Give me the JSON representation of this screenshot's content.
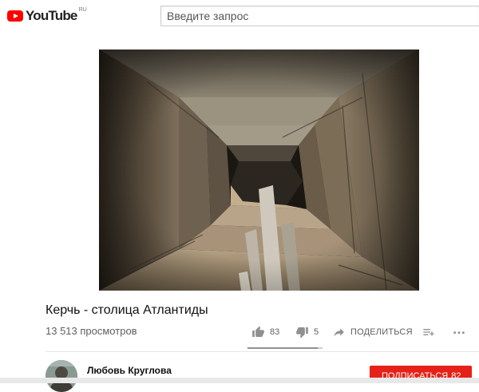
{
  "header": {
    "logo_text": "YouTube",
    "logo_region": "RU",
    "brand_color": "#ff0000",
    "search_placeholder": "Введите запрос"
  },
  "video": {
    "title": "Керчь - столица Атлантиды",
    "views": "13 513 просмотров",
    "likes": "83",
    "dislikes": "5",
    "share_label": "ПОДЕЛИТЬСЯ",
    "like_ratio": 0.94
  },
  "channel": {
    "name": "Любовь Круглова",
    "subscribe_label": "ПОДПИСАТЬСЯ",
    "subscriber_count": "82",
    "subscribe_color": "#e62117"
  },
  "icons": {
    "logo": "youtube-logo-icon",
    "like": "thumbs-up-icon",
    "dislike": "thumbs-down-icon",
    "share": "share-arrow-icon",
    "add": "add-to-playlist-icon",
    "more": "more-horizontal-icon"
  }
}
